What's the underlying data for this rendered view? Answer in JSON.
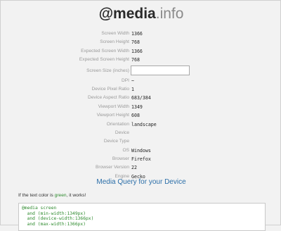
{
  "logo": {
    "prefix": "@media",
    "suffix": ".info"
  },
  "info_rows": [
    {
      "label": "Screen Width",
      "value": "1366"
    },
    {
      "label": "Screen Height",
      "value": "768"
    },
    {
      "label": "Expected Screen Width",
      "value": "1366"
    },
    {
      "label": "Expected Screen Height",
      "value": "768"
    },
    {
      "label": "Screen Size (inches)",
      "value": ""
    },
    {
      "label": "DPI",
      "value": "~"
    },
    {
      "label": "Device Pixel Ratio",
      "value": "1"
    },
    {
      "label": "Device Aspect Ratio",
      "value": "683/384"
    },
    {
      "label": "Viewport Width",
      "value": "1349"
    },
    {
      "label": "Viewport Height",
      "value": "608"
    },
    {
      "label": "Orientation",
      "value": "landscape"
    },
    {
      "label": "Device",
      "value": ""
    },
    {
      "label": "Device Type",
      "value": ""
    },
    {
      "label": "OS",
      "value": "Windows"
    },
    {
      "label": "Browser",
      "value": "Firefox"
    },
    {
      "label": "Browser Version",
      "value": "22"
    },
    {
      "label": "Engine",
      "value": "Gecko"
    }
  ],
  "media_query": {
    "heading": "Media Query for your Device",
    "note_before": "If the text color is ",
    "note_green": "green",
    "note_after": ", it works!",
    "code_lines": [
      "@media screen",
      "  and (min-width:1349px)",
      "  and (device-width:1366px)",
      "  and (max-width:1366px)"
    ]
  },
  "colors": {
    "heading": "#2a6ea8",
    "code": "#2d8a2d",
    "background": "#f2f2f2"
  }
}
